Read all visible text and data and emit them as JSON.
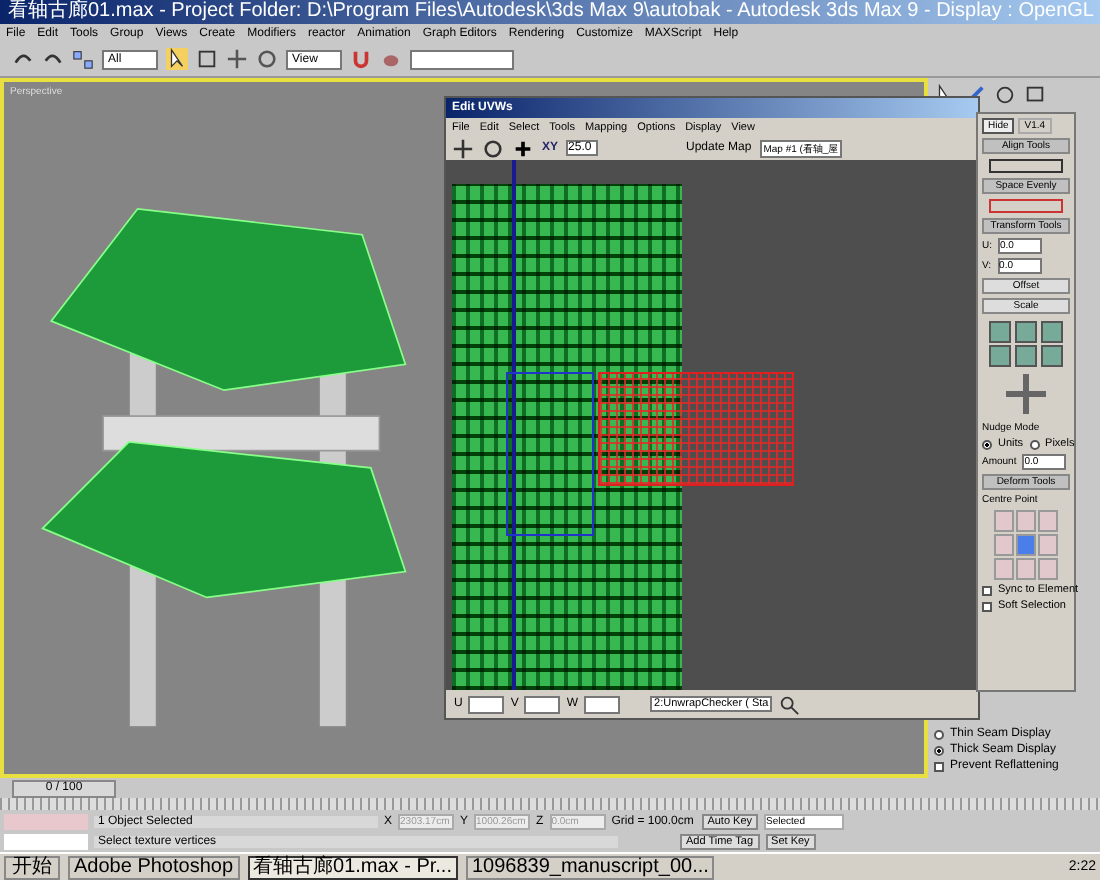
{
  "window": {
    "title": "看轴古廊01.max   - Project Folder: D:\\Program Files\\Autodesk\\3ds Max 9\\autobak   - Autodesk 3ds Max 9   - Display : OpenGL"
  },
  "menu": [
    "File",
    "Edit",
    "Tools",
    "Group",
    "Views",
    "Create",
    "Modifiers",
    "reactor",
    "Animation",
    "Graph Editors",
    "Rendering",
    "Customize",
    "MAXScript",
    "Help"
  ],
  "toolbar": {
    "selection_filter": "All",
    "reference_coord": "View"
  },
  "viewport": {
    "label": "Perspective"
  },
  "uvw_editor": {
    "title": "Edit UVWs",
    "menu": [
      "File",
      "Edit",
      "Select",
      "Tools",
      "Mapping",
      "Options",
      "Display",
      "View"
    ],
    "axis": "XY",
    "spinner": "25.0",
    "update_map": "Update Map",
    "map": "Map #1 (看轴_屋",
    "bottom": {
      "u_label": "U",
      "v_label": "V",
      "w_label": "W",
      "texture": "2:UnwrapChecker ( Sta"
    }
  },
  "rollout": {
    "tabs": [
      {
        "label": "Hide",
        "selected": true
      },
      {
        "label": "V1.4",
        "selected": false
      }
    ],
    "sections": [
      {
        "title": "Align Tools"
      },
      {
        "title": "Space Evenly"
      },
      {
        "title": "Transform Tools"
      }
    ],
    "u": {
      "label": "U:",
      "value": "0.0"
    },
    "v": {
      "label": "V:",
      "value": "0.0"
    },
    "buttons": [
      "Offset",
      "Scale"
    ],
    "nudge": {
      "title": "Nudge Mode",
      "options": [
        {
          "label": "Units",
          "selected": true
        },
        {
          "label": "Pixels",
          "selected": false
        }
      ],
      "amount_label": "Amount",
      "amount": "0.0"
    },
    "deform": {
      "title": "Deform Tools",
      "centre": "Centre Point"
    },
    "checks": [
      {
        "label": "Sync to Element",
        "checked": false
      },
      {
        "label": "Soft Selection",
        "checked": false
      }
    ]
  },
  "seam_display": [
    {
      "label": "Thin Seam Display",
      "selected": false
    },
    {
      "label": "Thick Seam Display",
      "selected": true
    }
  ],
  "prevent_reflattening": {
    "label": "Prevent Reflattening",
    "checked": false
  },
  "timeline": {
    "frame": "0 / 100"
  },
  "status": {
    "selected": "1 Object Selected",
    "prompt": "Select texture vertices",
    "x_label": "X",
    "x": "2303.17cm",
    "y_label": "Y",
    "y": "1000.26cm",
    "z_label": "Z",
    "z": "0.0cm",
    "grid": "Grid = 100.0cm",
    "time_tag": "Add Time Tag",
    "auto_key": "Auto Key",
    "key_filter": "Selected",
    "set_key": "Set Key"
  },
  "taskbar": {
    "start": "开始",
    "apps": [
      {
        "label": "Adobe Photoshop",
        "selected": false
      },
      {
        "label": "看轴古廊01.max  - Pr...",
        "selected": true
      },
      {
        "label": "1096839_manuscript_00...",
        "selected": false
      }
    ],
    "time": "2:22"
  }
}
